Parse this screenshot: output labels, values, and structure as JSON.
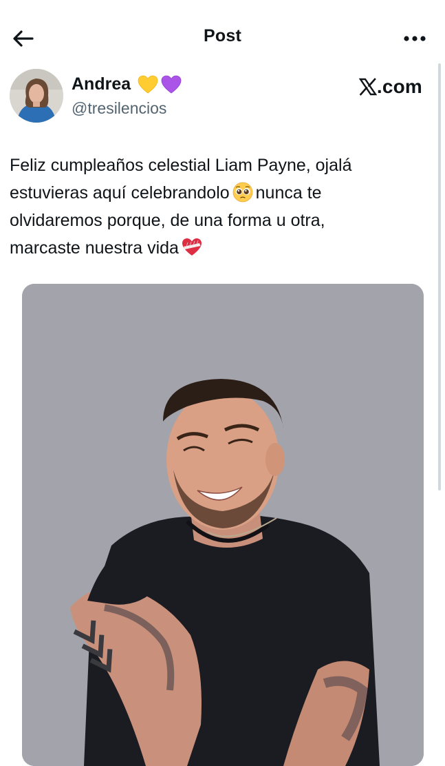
{
  "header": {
    "title": "Post",
    "back_icon": "arrow-left-icon",
    "more_icon": "more-horizontal-icon"
  },
  "author": {
    "display_name": "Andrea",
    "handle": "@tresilencios",
    "badges": [
      "yellow-heart-icon",
      "purple-heart-icon"
    ],
    "source": ".com",
    "source_logo": "x-logo-icon"
  },
  "post": {
    "text_line1": "Feliz cumpleaños celestial Liam Payne, ojalá",
    "text_line2a": "estuvieras aquí celebrandolo",
    "text_line2b": "nunca te",
    "text_line3": "olvidaremos porque, de una forma u otra,",
    "text_line4": "marcaste nuestra vida",
    "emoji_1": "pleading-face-icon",
    "emoji_2": "mending-heart-icon"
  },
  "colors": {
    "text": "#0f1419",
    "secondary": "#536471",
    "yellow_heart": "#FFCC32",
    "purple_heart": "#AA55E8",
    "photo_background": "#A4A4AC"
  }
}
